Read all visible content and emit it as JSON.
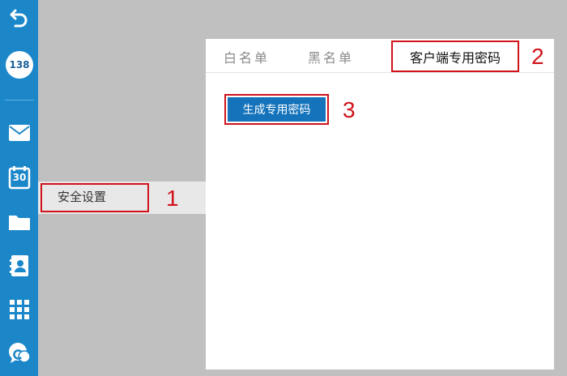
{
  "sidebar": {
    "logo_text": "138",
    "icons": [
      "back-icon",
      "mail-icon",
      "calendar-icon",
      "folder-icon",
      "contacts-icon",
      "apps-grid-icon",
      "chat-icon"
    ],
    "calendar_day": "30"
  },
  "menu": {
    "security_settings": "安全设置"
  },
  "tabs": {
    "whitelist": "白名单",
    "blacklist": "黑名单",
    "client_password": "客户端专用密码"
  },
  "actions": {
    "generate_password": "生成专用密码"
  },
  "annotations": {
    "step1": "1",
    "step2": "2",
    "step3": "3"
  },
  "colors": {
    "rail": "#1b87c9",
    "highlight": "#d0121b",
    "button": "#1573bb"
  }
}
